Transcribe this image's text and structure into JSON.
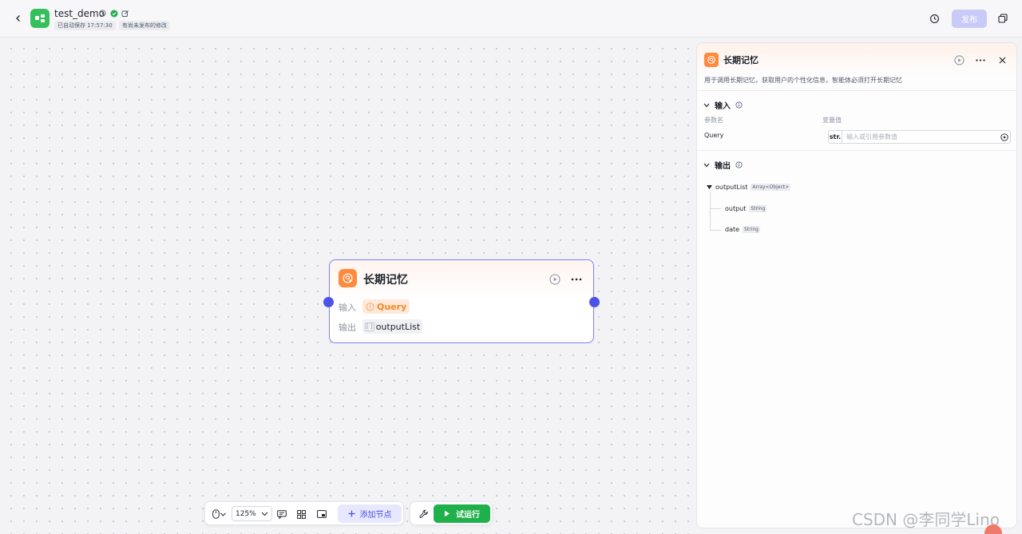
{
  "header": {
    "app_title": "test_demo",
    "saved_tag": "已自动保存 17:57:30",
    "unpublished_tag": "有尚未发布的修改",
    "publish_label": "发布"
  },
  "node": {
    "title": "长期记忆",
    "input_label": "输入",
    "input_value": "Query",
    "output_label": "输出",
    "output_value": "outputList"
  },
  "toolbar": {
    "zoom": "125%",
    "add_node_label": "添加节点",
    "trial_run_label": "试运行"
  },
  "panel": {
    "title": "长期记忆",
    "description": "用于调用长期记忆，获取用户的个性化信息，智能体必须打开长期记忆",
    "input_section": "输入",
    "col_param_name": "参数名",
    "col_var_value": "变量值",
    "param_name": "Query",
    "param_type": "str.",
    "param_placeholder": "输入或引用参数值",
    "output_section": "输出",
    "output_root": {
      "name": "outputList",
      "type": "Array<Object>"
    },
    "output_children": [
      {
        "name": "output",
        "type": "String"
      },
      {
        "name": "date",
        "type": "String"
      }
    ]
  },
  "watermark": "CSDN @李同学Lino",
  "colors": {
    "accent": "#4d53e8",
    "node_icon": "#ff8a3d",
    "trial_run": "#1fb04b",
    "app_logo": "#34c05c"
  }
}
